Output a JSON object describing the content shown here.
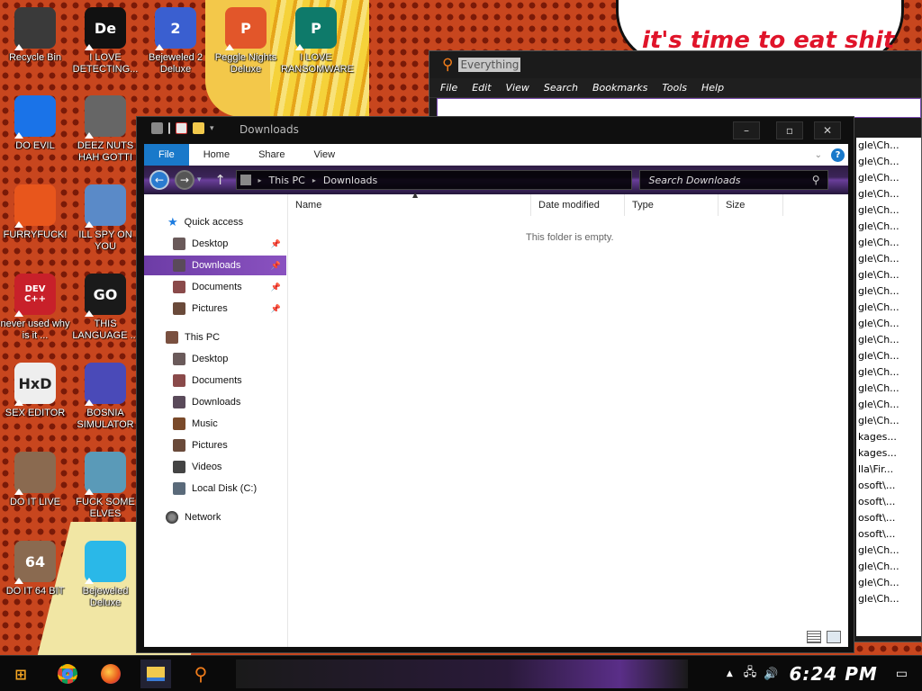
{
  "wallpaper": {
    "bubble_text": "it's time to eat shit"
  },
  "desktop_icons": [
    {
      "label": "Recycle Bin",
      "icon": "recycle-bin-icon",
      "color": "#3a3a3a"
    },
    {
      "label": "I LOVE DETECTING...",
      "icon": "de-app-icon",
      "glyph": "De",
      "color": "#111111"
    },
    {
      "label": "Bejeweled 2 Deluxe",
      "icon": "bejeweled-2-icon",
      "glyph": "2",
      "color": "#3a5fd0"
    },
    {
      "label": "Peggle Nights Deluxe",
      "icon": "peggle-icon",
      "glyph": "P",
      "color": "#e2562a"
    },
    {
      "label": "I LOVE RANSOMWARE",
      "icon": "publisher-icon",
      "glyph": "P",
      "color": "#0e7a6a"
    },
    {
      "label": "DO EVIL",
      "icon": "chrome-icon",
      "color": "#1a73e8"
    },
    {
      "label": "DEEZ NUTS HAH GOTTI",
      "icon": "stacked-windows-icon",
      "color": "#666666"
    },
    {
      "label": "FURRYFUCK!",
      "icon": "firefox-icon",
      "color": "#e8561c"
    },
    {
      "label": "ILL SPY ON YOU",
      "icon": "network-monitor-icon",
      "color": "#5a8ac8"
    },
    {
      "label": "never used why is it ...",
      "icon": "devcpp-icon",
      "glyph": "DEV C++",
      "color": "#c8202a"
    },
    {
      "label": "THIS LANGUAGE ...",
      "icon": "goland-icon",
      "glyph": "GO",
      "color": "#1a1a1a"
    },
    {
      "label": "SEX EDITOR",
      "icon": "hxd-icon",
      "glyph": "HxD",
      "color": "#eeeeee"
    },
    {
      "label": "BOSNIA SIMULATOR",
      "icon": "mine-icon",
      "color": "#4a4ab8"
    },
    {
      "label": "DO IT LIVE",
      "icon": "portrait-icon",
      "color": "#8a6a50"
    },
    {
      "label": "FUCK SOME ELVES",
      "icon": "santa-icon",
      "color": "#5a9ab8"
    },
    {
      "label": "DO IT 64 BIT",
      "icon": "portrait-64-icon",
      "glyph": "64",
      "color": "#8a6a50"
    },
    {
      "label": "Bejeweled Deluxe",
      "icon": "diamond-icon",
      "color": "#2ab8e8"
    }
  ],
  "everything_window": {
    "title": "Everything",
    "menu": [
      "File",
      "Edit",
      "View",
      "Search",
      "Bookmarks",
      "Tools",
      "Help"
    ],
    "partial_rows": [
      "gle\\Ch...",
      "gle\\Ch...",
      "gle\\Ch...",
      "gle\\Ch...",
      "gle\\Ch...",
      "gle\\Ch...",
      "gle\\Ch...",
      "gle\\Ch...",
      "gle\\Ch...",
      "gle\\Ch...",
      "gle\\Ch...",
      "gle\\Ch...",
      "gle\\Ch...",
      "gle\\Ch...",
      "gle\\Ch...",
      "gle\\Ch...",
      "gle\\Ch...",
      "gle\\Ch...",
      "kages...",
      "kages...",
      "lla\\Fir...",
      "osoft\\...",
      "osoft\\...",
      "osoft\\...",
      "osoft\\...",
      "gle\\Ch...",
      "gle\\Ch...",
      "gle\\Ch...",
      "gle\\Ch..."
    ]
  },
  "explorer": {
    "title": "Downloads",
    "window_buttons": {
      "minimize": "–",
      "maximize": "▫",
      "close": "✕"
    },
    "ribbon_tabs": [
      "File",
      "Home",
      "Share",
      "View"
    ],
    "help_label": "?",
    "breadcrumb": [
      "This PC",
      "Downloads"
    ],
    "search_placeholder": "Search Downloads",
    "nav": {
      "quick_access": "Quick access",
      "quick_items": [
        {
          "label": "Desktop",
          "icon": "desktop-folder-icon",
          "pinned": true
        },
        {
          "label": "Downloads",
          "icon": "downloads-folder-icon",
          "pinned": true,
          "selected": true
        },
        {
          "label": "Documents",
          "icon": "documents-folder-icon",
          "pinned": true
        },
        {
          "label": "Pictures",
          "icon": "pictures-folder-icon",
          "pinned": true
        }
      ],
      "this_pc": "This PC",
      "pc_items": [
        {
          "label": "Desktop",
          "icon": "desktop-folder-icon"
        },
        {
          "label": "Documents",
          "icon": "documents-folder-icon"
        },
        {
          "label": "Downloads",
          "icon": "downloads-folder-icon"
        },
        {
          "label": "Music",
          "icon": "music-folder-icon"
        },
        {
          "label": "Pictures",
          "icon": "pictures-folder-icon"
        },
        {
          "label": "Videos",
          "icon": "videos-folder-icon"
        },
        {
          "label": "Local Disk (C:)",
          "icon": "local-disk-icon"
        }
      ],
      "network": "Network"
    },
    "columns": [
      "Name",
      "Date modified",
      "Type",
      "Size"
    ],
    "empty_message": "This folder is empty."
  },
  "taskbar": {
    "clock": "6:24 PM",
    "apps": [
      "start-icon",
      "chrome-icon",
      "firefox-icon",
      "explorer-icon",
      "everything-icon"
    ]
  }
}
